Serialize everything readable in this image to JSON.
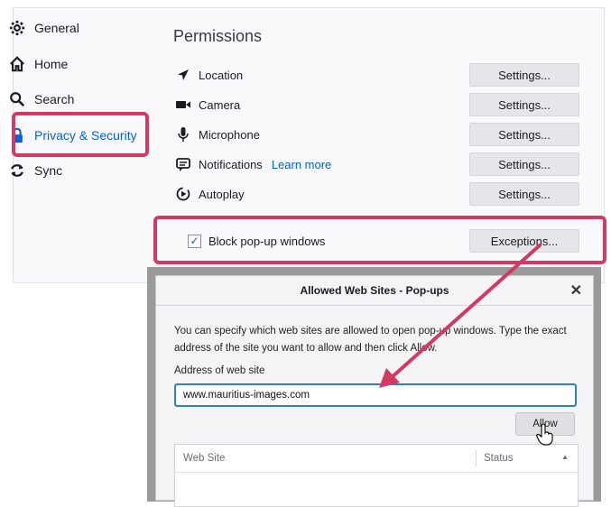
{
  "sidebar": {
    "items": [
      {
        "label": "General",
        "icon": "gear-icon"
      },
      {
        "label": "Home",
        "icon": "home-icon"
      },
      {
        "label": "Search",
        "icon": "search-icon"
      },
      {
        "label": "Privacy & Security",
        "icon": "lock-icon",
        "active": true
      },
      {
        "label": "Sync",
        "icon": "sync-icon"
      }
    ]
  },
  "permissions": {
    "title": "Permissions",
    "rows": [
      {
        "label": "Location",
        "icon": "location-arrow-icon",
        "button": "Settings..."
      },
      {
        "label": "Camera",
        "icon": "camera-icon",
        "button": "Settings..."
      },
      {
        "label": "Microphone",
        "icon": "microphone-icon",
        "button": "Settings..."
      },
      {
        "label": "Notifications",
        "icon": "notification-icon",
        "link": "Learn more",
        "button": "Settings..."
      },
      {
        "label": "Autoplay",
        "icon": "autoplay-icon",
        "button": "Settings..."
      }
    ],
    "popup_block": {
      "label": "Block pop-up windows",
      "checked": true,
      "button": "Exceptions..."
    }
  },
  "dialog": {
    "title": "Allowed Web Sites - Pop-ups",
    "description_line1": "You can specify which web sites are allowed to open pop-up windows. Type the exact",
    "description_line2": "address of the site you want to allow and then click Allow.",
    "address_label": "Address of web site",
    "address_value": "www.mauritius-images.com",
    "allow_button": "Allow",
    "columns": [
      "Web Site",
      "Status"
    ]
  },
  "colors": {
    "highlight": "#d13b63",
    "accent": "#0060df"
  }
}
